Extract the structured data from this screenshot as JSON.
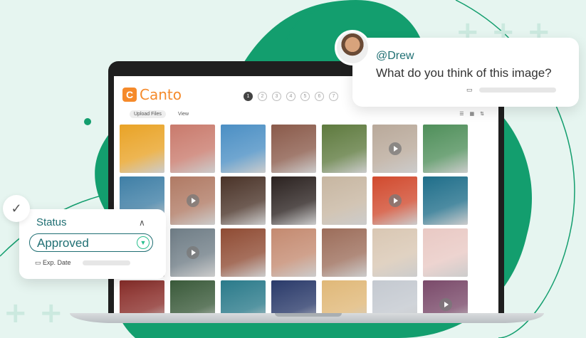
{
  "colors": {
    "accent": "#139e6e",
    "teal": "#1f6f73",
    "brand_orange": "#f58a2b"
  },
  "app": {
    "logo_letter": "C",
    "logo_text": "Canto",
    "step_labels": [
      "1",
      "2",
      "3",
      "4",
      "5",
      "6",
      "7"
    ],
    "toolbar": {
      "upload_label": "Upload Files",
      "view_label": "View"
    }
  },
  "grid_tiles": [
    {
      "color": "#e9a326",
      "video": false
    },
    {
      "color": "#c97a6c",
      "video": false
    },
    {
      "color": "#4b8fc4",
      "video": false
    },
    {
      "color": "#8a5a4a",
      "video": false
    },
    {
      "color": "#5e7a3e",
      "video": false
    },
    {
      "color": "#b9a99a",
      "video": true
    },
    {
      "color": "#4f8f5a",
      "video": false
    },
    {
      "color": "#3f7fa6",
      "video": false
    },
    {
      "color": "#b07a64",
      "video": true
    },
    {
      "color": "#4a3328",
      "video": false
    },
    {
      "color": "#2b2220",
      "video": false
    },
    {
      "color": "#c7b6a1",
      "video": false
    },
    {
      "color": "#d14a2e",
      "video": true
    },
    {
      "color": "#1f6e8a",
      "video": false
    },
    {
      "color": "#8a4f3a",
      "video": false
    },
    {
      "color": "#6f7d86",
      "video": true
    },
    {
      "color": "#8f4b33",
      "video": false
    },
    {
      "color": "#c48a70",
      "video": false
    },
    {
      "color": "#9c6d5a",
      "video": false
    },
    {
      "color": "#d9c7b3",
      "video": false
    },
    {
      "color": "#e9c9c4",
      "video": false
    },
    {
      "color": "#8a2e2a",
      "video": false
    },
    {
      "color": "#3a5a3a",
      "video": false
    },
    {
      "color": "#2a7a8a",
      "video": false
    },
    {
      "color": "#2a3a6a",
      "video": false
    },
    {
      "color": "#e0b878",
      "video": false
    },
    {
      "color": "#c4c9d0",
      "video": false
    },
    {
      "color": "#7a4a6a",
      "video": true
    }
  ],
  "comment": {
    "user": "@Drew",
    "text": "What do you think of this image?",
    "calendar_icon": "calendar-icon"
  },
  "status": {
    "label": "Status",
    "value": "Approved",
    "date_label": "Exp. Date",
    "check_icon": "checkmark-icon"
  }
}
